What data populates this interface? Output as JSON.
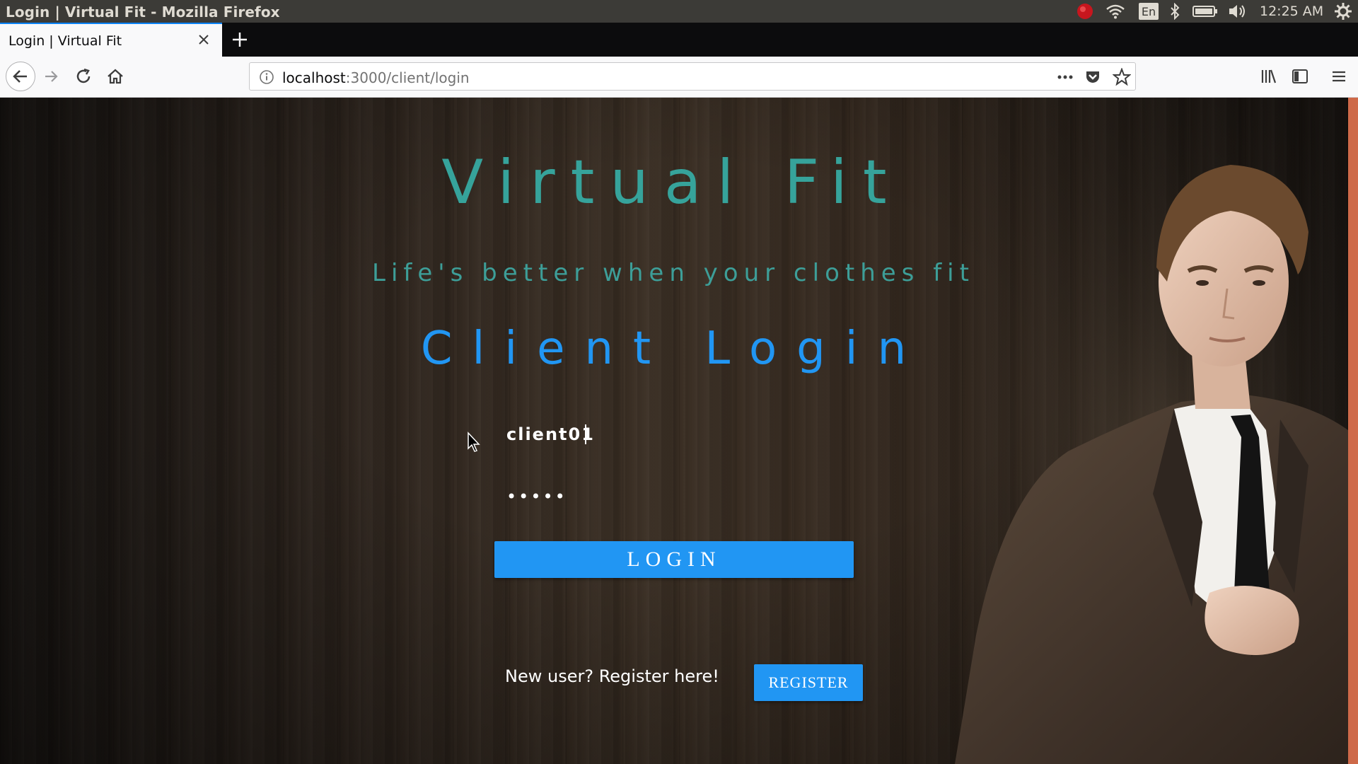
{
  "os": {
    "window_title": "Login | Virtual Fit - Mozilla Firefox",
    "keyboard_layout": "En",
    "clock": "12:25 AM"
  },
  "browser": {
    "tab_title": "Login | Virtual Fit",
    "url_host": "localhost",
    "url_path": ":3000/client/login"
  },
  "page": {
    "brand": "Virtual Fit",
    "tagline": "Life's better when your clothes fit",
    "heading": "Client Login",
    "username_value": "client01",
    "password_value": "•••••",
    "login_label": "LOGIN",
    "register_prompt": "New user? Register here!",
    "register_label": "REGISTER"
  },
  "colors": {
    "brand_teal": "#36a39b",
    "accent_blue": "#2196f3",
    "tab_highlight": "#0a84ff"
  }
}
